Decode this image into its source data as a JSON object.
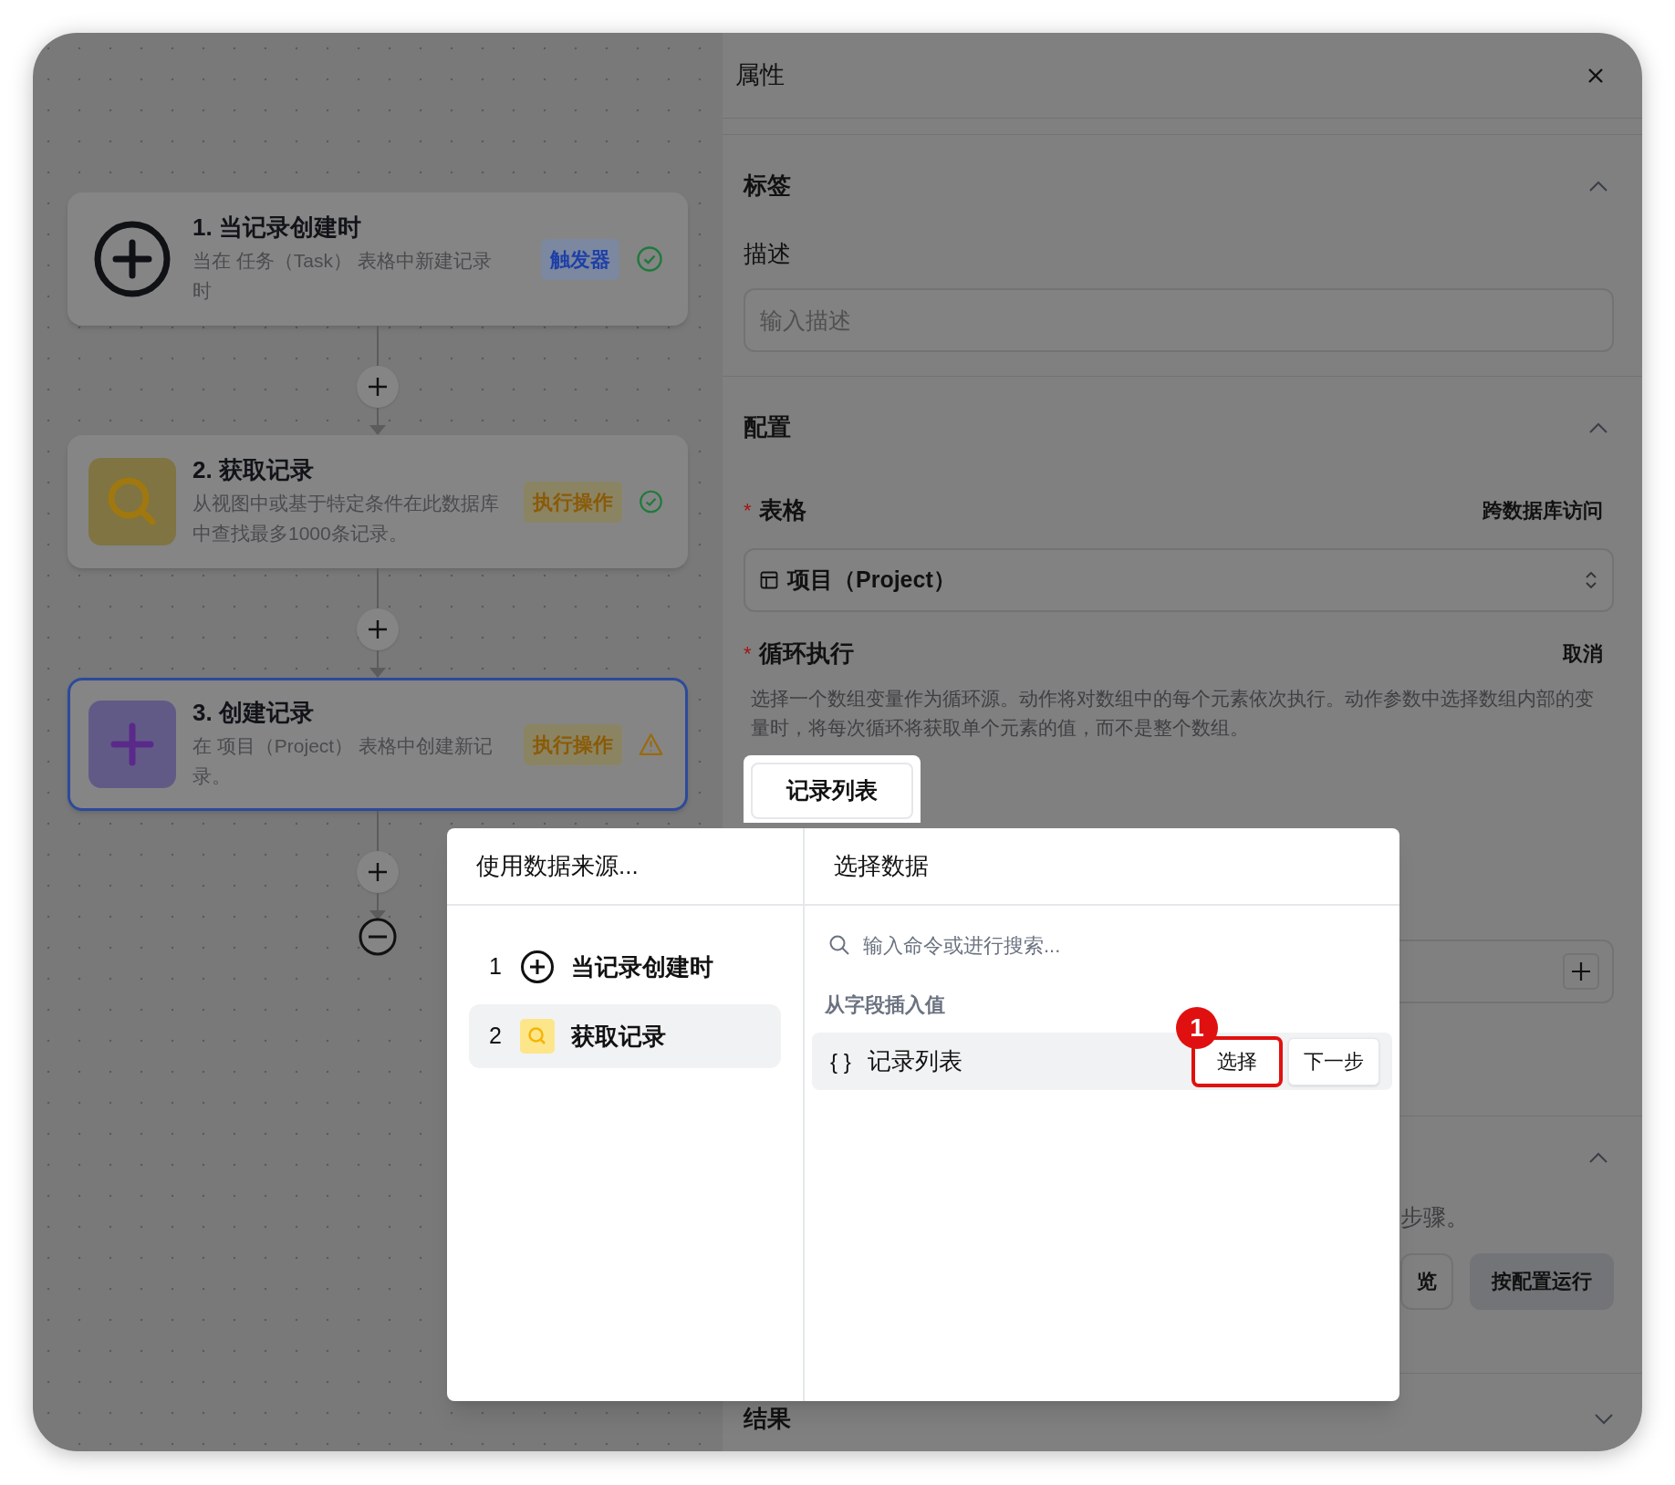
{
  "canvas": {
    "steps": [
      {
        "title": "1. 当记录创建时",
        "description": "当在 任务（Task） 表格中新建记录时",
        "badge": "触发器",
        "kind": "trigger",
        "warning": false,
        "selected": false
      },
      {
        "title": "2. 获取记录",
        "description": "从视图中或基于特定条件在此数据库中查找最多1000条记录。",
        "badge": "执行操作",
        "kind": "search",
        "warning": false,
        "selected": false
      },
      {
        "title": "3. 创建记录",
        "description": "在 项目（Project） 表格中创建新记录。",
        "badge": "执行操作",
        "kind": "create",
        "warning": true,
        "selected": true
      }
    ]
  },
  "panel": {
    "title": "属性",
    "label_section": {
      "title": "标签",
      "expanded": true,
      "field_label": "描述",
      "placeholder": "输入描述"
    },
    "config_section": {
      "title": "配置",
      "expanded": true,
      "required_mark": "*",
      "table_label": "表格",
      "table_link": "跨数据库访问",
      "table_value": "项目（Project）",
      "loop_label": "循环执行",
      "loop_link": "取消",
      "loop_help": "选择一个数组变量作为循环源。动作将对数组中的每个元素依次执行。动作参数中选择数组内部的变量时，将每次循环将获取单个元素的值，而不是整个数组。",
      "loop_tab": "记录列表"
    },
    "run_section": {
      "expanded": true,
      "hint": "步骤。",
      "buttons": [
        "览",
        "按配置运行"
      ]
    },
    "result_section": {
      "title": "结果",
      "expanded": false
    }
  },
  "picker": {
    "sources_header": "使用数据来源...",
    "data_header": "选择数据",
    "sources": [
      {
        "number": "1",
        "label": "当记录创建时",
        "kind": "trigger",
        "selected": false
      },
      {
        "number": "2",
        "label": "获取记录",
        "kind": "search",
        "selected": true
      }
    ],
    "search_placeholder": "输入命令或进行搜索...",
    "group_label": "从字段插入值",
    "fields": [
      {
        "symbol": "{ }",
        "label": "记录列表",
        "buttons": [
          "选择",
          "下一步"
        ]
      }
    ],
    "callout": "1"
  }
}
